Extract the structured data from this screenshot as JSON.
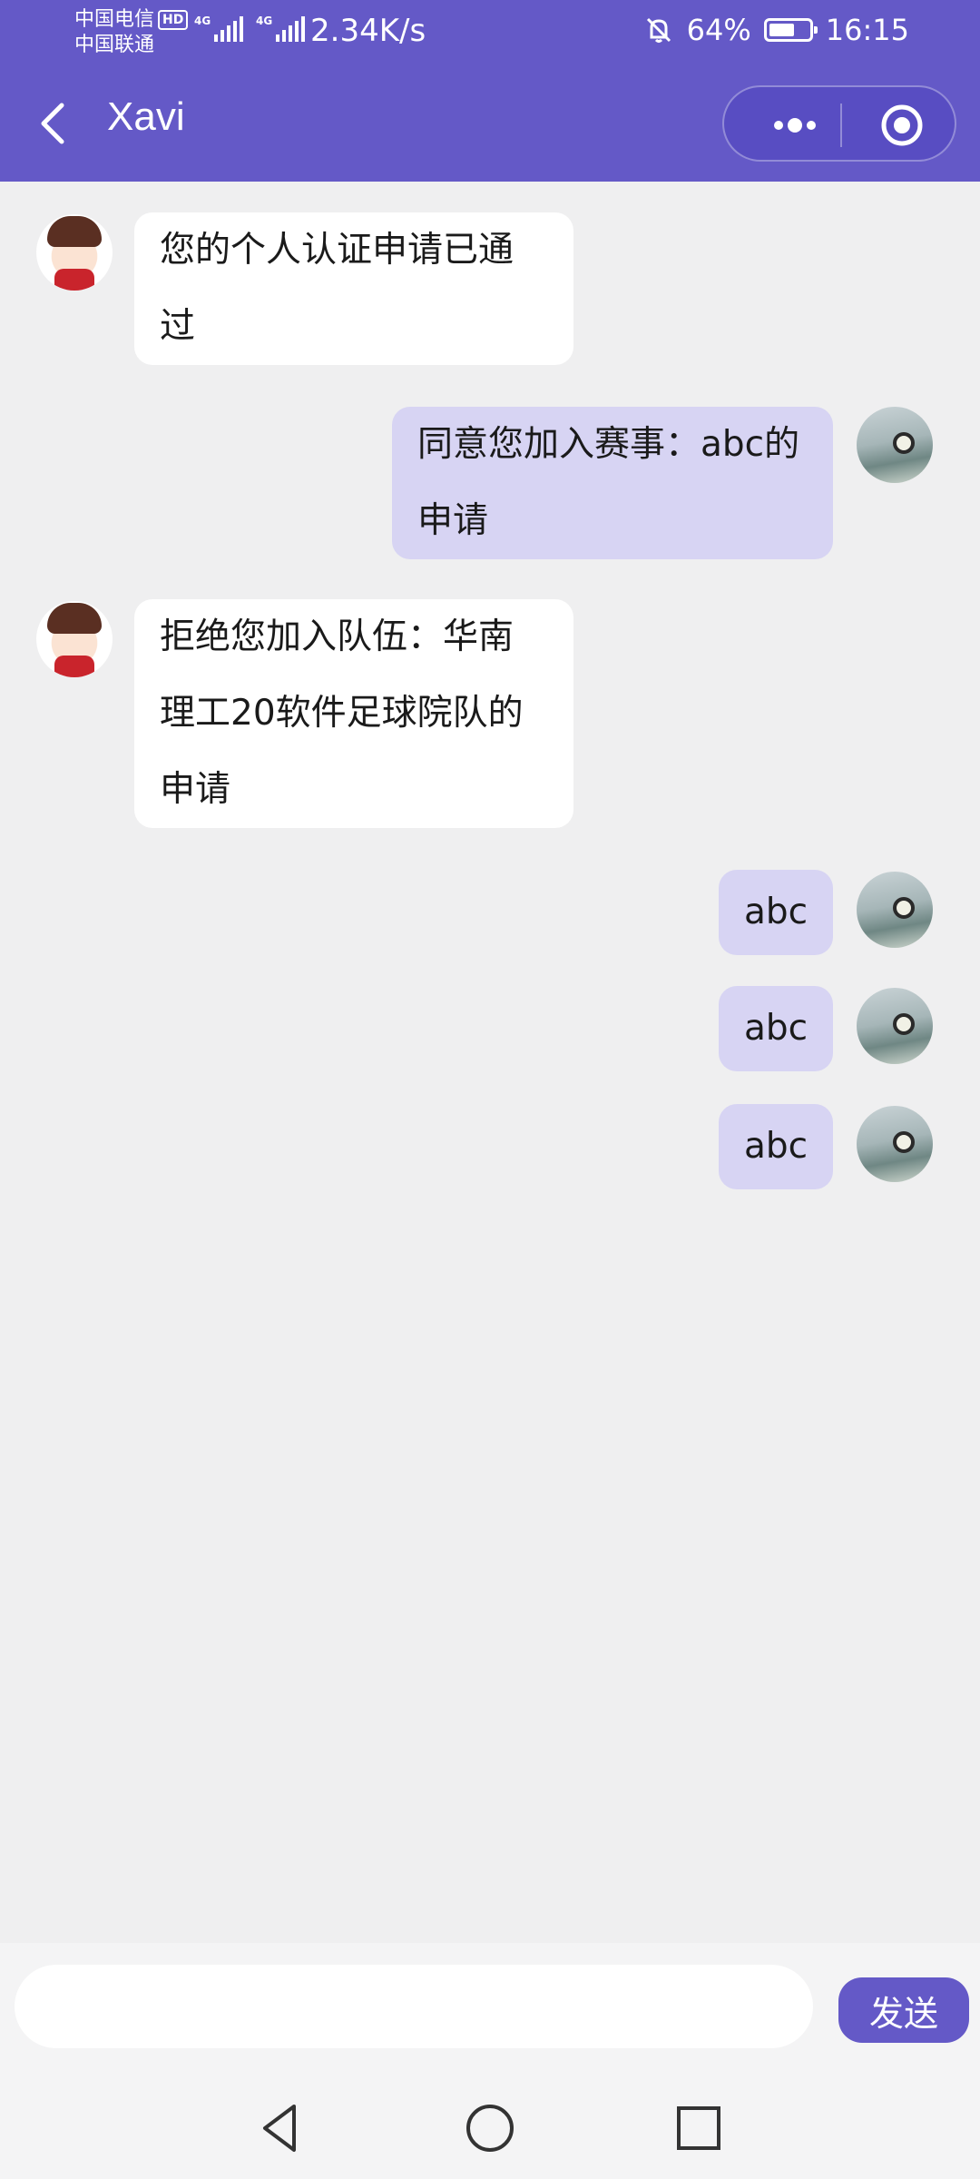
{
  "status_bar": {
    "carrier_1": "中国电信",
    "carrier_1_badge": "HD",
    "carrier_2": "中国联通",
    "network_1": "4G",
    "network_2": "4G",
    "net_speed": "2.34K/s",
    "battery": "64%",
    "battery_level": 0.64,
    "time": "16:15"
  },
  "nav": {
    "title": "Xavi"
  },
  "messages": [
    {
      "side": "left",
      "avatar": "cartoon-avatar",
      "text": "您的个人认证申请已通过"
    },
    {
      "side": "right",
      "avatar": "photo-avatar",
      "text": "同意您加入赛事：abc的申请"
    },
    {
      "side": "left",
      "avatar": "cartoon-avatar",
      "text": "拒绝您加入队伍：华南理工20软件足球院队的申请"
    },
    {
      "side": "right",
      "avatar": "photo-avatar",
      "text": "abc"
    },
    {
      "side": "right",
      "avatar": "photo-avatar",
      "text": "abc"
    },
    {
      "side": "right",
      "avatar": "photo-avatar",
      "text": "abc"
    }
  ],
  "input": {
    "value": "",
    "send_label": "发送"
  },
  "colors": {
    "accent": "#6459c7",
    "bubble_self": "#d7d4f3",
    "bubble_other": "#ffffff",
    "background": "#efeff0"
  }
}
